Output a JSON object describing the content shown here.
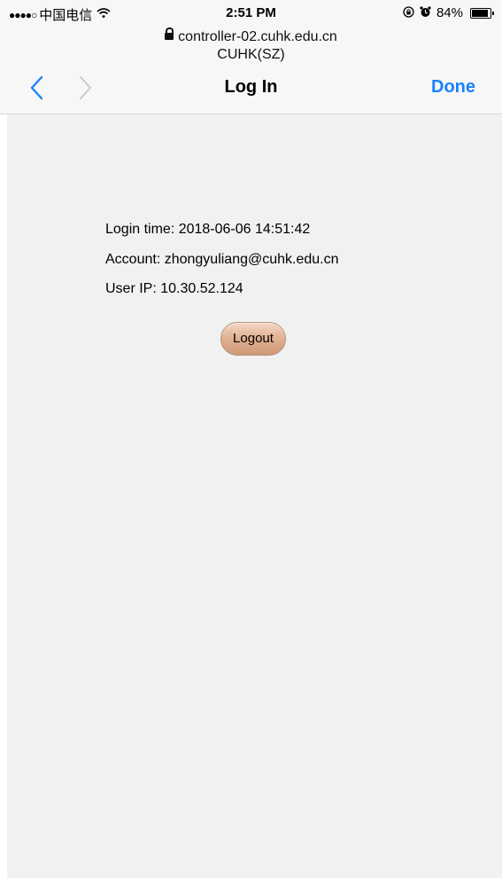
{
  "status_bar": {
    "carrier": "中国电信",
    "signal_dots": "●●●●○",
    "time": "2:51 PM",
    "battery": "84%",
    "icons": [
      "wifi-icon",
      "rotation-lock-icon",
      "alarm-icon",
      "battery-icon"
    ]
  },
  "browser": {
    "url": "controller-02.cuhk.edu.cn",
    "site_name": "CUHK(SZ)"
  },
  "nav": {
    "title": "Log In",
    "done_label": "Done",
    "accent_color": "#1a82fb"
  },
  "login_info": {
    "login_time": "Login time: 2018-06-06 14:51:42",
    "account": "Account: zhongyuliang@cuhk.edu.cn",
    "user_ip": "User IP: 10.30.52.124"
  },
  "logout_label": "Logout"
}
